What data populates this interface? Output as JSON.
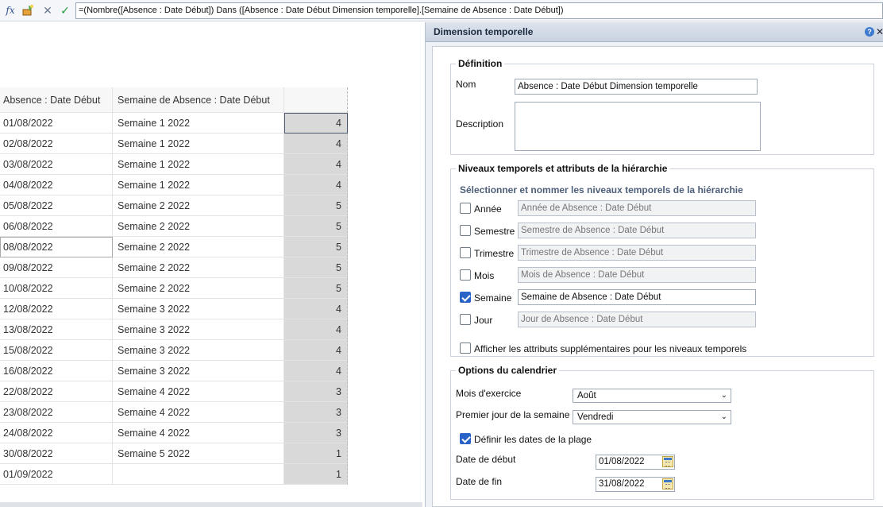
{
  "formula_bar": {
    "fx_icon": "fx-icon",
    "formula": "=(Nombre([Absence : Date Début]) Dans ([Absence : Date Début Dimension temporelle].[Semaine de Absence : Date Début])"
  },
  "table": {
    "headers": [
      "Absence : Date Début",
      "Semaine de Absence : Date Début",
      ""
    ],
    "rows": [
      {
        "date": "01/08/2022",
        "week": "Semaine 1 2022",
        "count": "4"
      },
      {
        "date": "02/08/2022",
        "week": "Semaine 1 2022",
        "count": "4"
      },
      {
        "date": "03/08/2022",
        "week": "Semaine 1 2022",
        "count": "4"
      },
      {
        "date": "04/08/2022",
        "week": "Semaine 1 2022",
        "count": "4"
      },
      {
        "date": "05/08/2022",
        "week": "Semaine 2 2022",
        "count": "5"
      },
      {
        "date": "06/08/2022",
        "week": "Semaine 2 2022",
        "count": "5"
      },
      {
        "date": "08/08/2022",
        "week": "Semaine 2 2022",
        "count": "5"
      },
      {
        "date": "09/08/2022",
        "week": "Semaine 2 2022",
        "count": "5"
      },
      {
        "date": "10/08/2022",
        "week": "Semaine 2 2022",
        "count": "5"
      },
      {
        "date": "12/08/2022",
        "week": "Semaine 3 2022",
        "count": "4"
      },
      {
        "date": "13/08/2022",
        "week": "Semaine 3 2022",
        "count": "4"
      },
      {
        "date": "15/08/2022",
        "week": "Semaine 3 2022",
        "count": "4"
      },
      {
        "date": "16/08/2022",
        "week": "Semaine 3 2022",
        "count": "4"
      },
      {
        "date": "22/08/2022",
        "week": "Semaine 4 2022",
        "count": "3"
      },
      {
        "date": "23/08/2022",
        "week": "Semaine 4 2022",
        "count": "3"
      },
      {
        "date": "24/08/2022",
        "week": "Semaine 4 2022",
        "count": "3"
      },
      {
        "date": "30/08/2022",
        "week": "Semaine 5 2022",
        "count": "1"
      },
      {
        "date": "01/09/2022",
        "week": "",
        "count": "1"
      }
    ]
  },
  "panel": {
    "title": "Dimension temporelle",
    "help": "?",
    "definition": {
      "legend": "Définition",
      "name_label": "Nom",
      "name_value": "Absence : Date Début Dimension temporelle",
      "description_label": "Description",
      "description_value": ""
    },
    "levels": {
      "legend": "Niveaux temporels et attributs de la hiérarchie",
      "subtitle": "Sélectionner et nommer les niveaux temporels de la hiérarchie",
      "items": [
        {
          "label": "Année",
          "value": "Année de Absence : Date Début",
          "checked": false
        },
        {
          "label": "Semestre",
          "value": "Semestre de Absence : Date Début",
          "checked": false
        },
        {
          "label": "Trimestre",
          "value": "Trimestre de Absence : Date Début",
          "checked": false
        },
        {
          "label": "Mois",
          "value": "Mois de Absence : Date Début",
          "checked": false
        },
        {
          "label": "Semaine",
          "value": "Semaine de Absence : Date Début",
          "checked": true
        },
        {
          "label": "Jour",
          "value": "Jour de Absence : Date Début",
          "checked": false
        }
      ],
      "extra_attributes_label": "Afficher les attributs supplémentaires pour les niveaux temporels"
    },
    "calendar": {
      "legend": "Options du calendrier",
      "fiscal_month_label": "Mois d'exercice",
      "fiscal_month_value": "Août",
      "first_day_label": "Premier jour de la semaine",
      "first_day_value": "Vendredi",
      "define_range_label": "Définir les dates de la plage",
      "start_label": "Date de début",
      "start_value": "01/08/2022",
      "end_label": "Date de fin",
      "end_value": "31/08/2022"
    }
  },
  "colors": {
    "accent": "#2a63c7",
    "panel_bg": "#eef1f5",
    "total_col": "#d9d9d9"
  }
}
